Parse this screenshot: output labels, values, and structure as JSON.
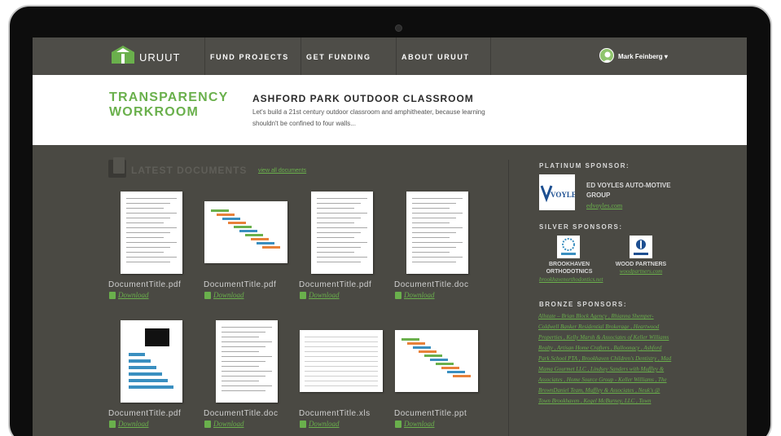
{
  "nav": {
    "logo_text": "URUUT",
    "items": [
      "FUND PROJECTS",
      "GET FUNDING",
      "ABOUT URUUT"
    ],
    "user_name": "Mark Feinberg ▾"
  },
  "header": {
    "title_line1": "TRANSPARENCY",
    "title_line2": "WORKROOM",
    "project_title": "ASHFORD PARK OUTDOOR CLASSROOM",
    "project_description": "Let's build a 21st century outdoor classroom and amphitheater, because learning shouldn't be confined to four walls..."
  },
  "documents": {
    "heading": "LATEST DOCUMENTS",
    "view_all": "view all documents",
    "download_label": "Download",
    "items": [
      {
        "title": "DocumentTitle.pdf",
        "kind": "text"
      },
      {
        "title": "DocumentTitle.pdf",
        "kind": "gantt"
      },
      {
        "title": "DocumentTitle.pdf",
        "kind": "text"
      },
      {
        "title": "DocumentTitle.doc",
        "kind": "text"
      },
      {
        "title": "DocumentTitle.pdf",
        "kind": "chart"
      },
      {
        "title": "DocumentTitle.doc",
        "kind": "text"
      },
      {
        "title": "DocumentTitle.xls",
        "kind": "sheet"
      },
      {
        "title": "DocumentTitle.ppt",
        "kind": "gantt"
      }
    ]
  },
  "sponsors": {
    "platinum_heading": "PLATINUM SPONSOR:",
    "platinum": {
      "logo_text": "VOYLES",
      "name": "ED VOYLES AUTO-MOTIVE GROUP",
      "url": "edvoyles.com"
    },
    "silver_heading": "SILVER SPONSORS:",
    "silver": [
      {
        "name": "BROOKHAVEN ORTHODOTNICS",
        "url": "brookhavenorthodontics.net"
      },
      {
        "name": "WOOD PARTNERS",
        "url": "woodpartners.com"
      }
    ],
    "bronze_heading": "BRONZE SPONSORS:",
    "bronze_text": "Allstate – Brian Block Agency , Rhianna Shemper- Coldwell Banker Residential Brokerage , Heartwood Properties , Kelly Marsh & Associates of Keller Williams Realty , Artisan Home Crafters , Balloonacy , Ashford Park School PTA , Brookhaven Children's Dentistry , Mad Mama Gourmet LLC , Lindsey Sanders with Muffley & Associates , Home Source Group - Keller Williams , The BrownDaniel Team, Muffley & Associates , Neuk's @ Town Brookhaven , Kegel McBurney, LLC , Town"
  },
  "colors": {
    "accent": "#6ab04c",
    "nav_bg": "#4e4d48",
    "page_bg": "#4a4943"
  }
}
